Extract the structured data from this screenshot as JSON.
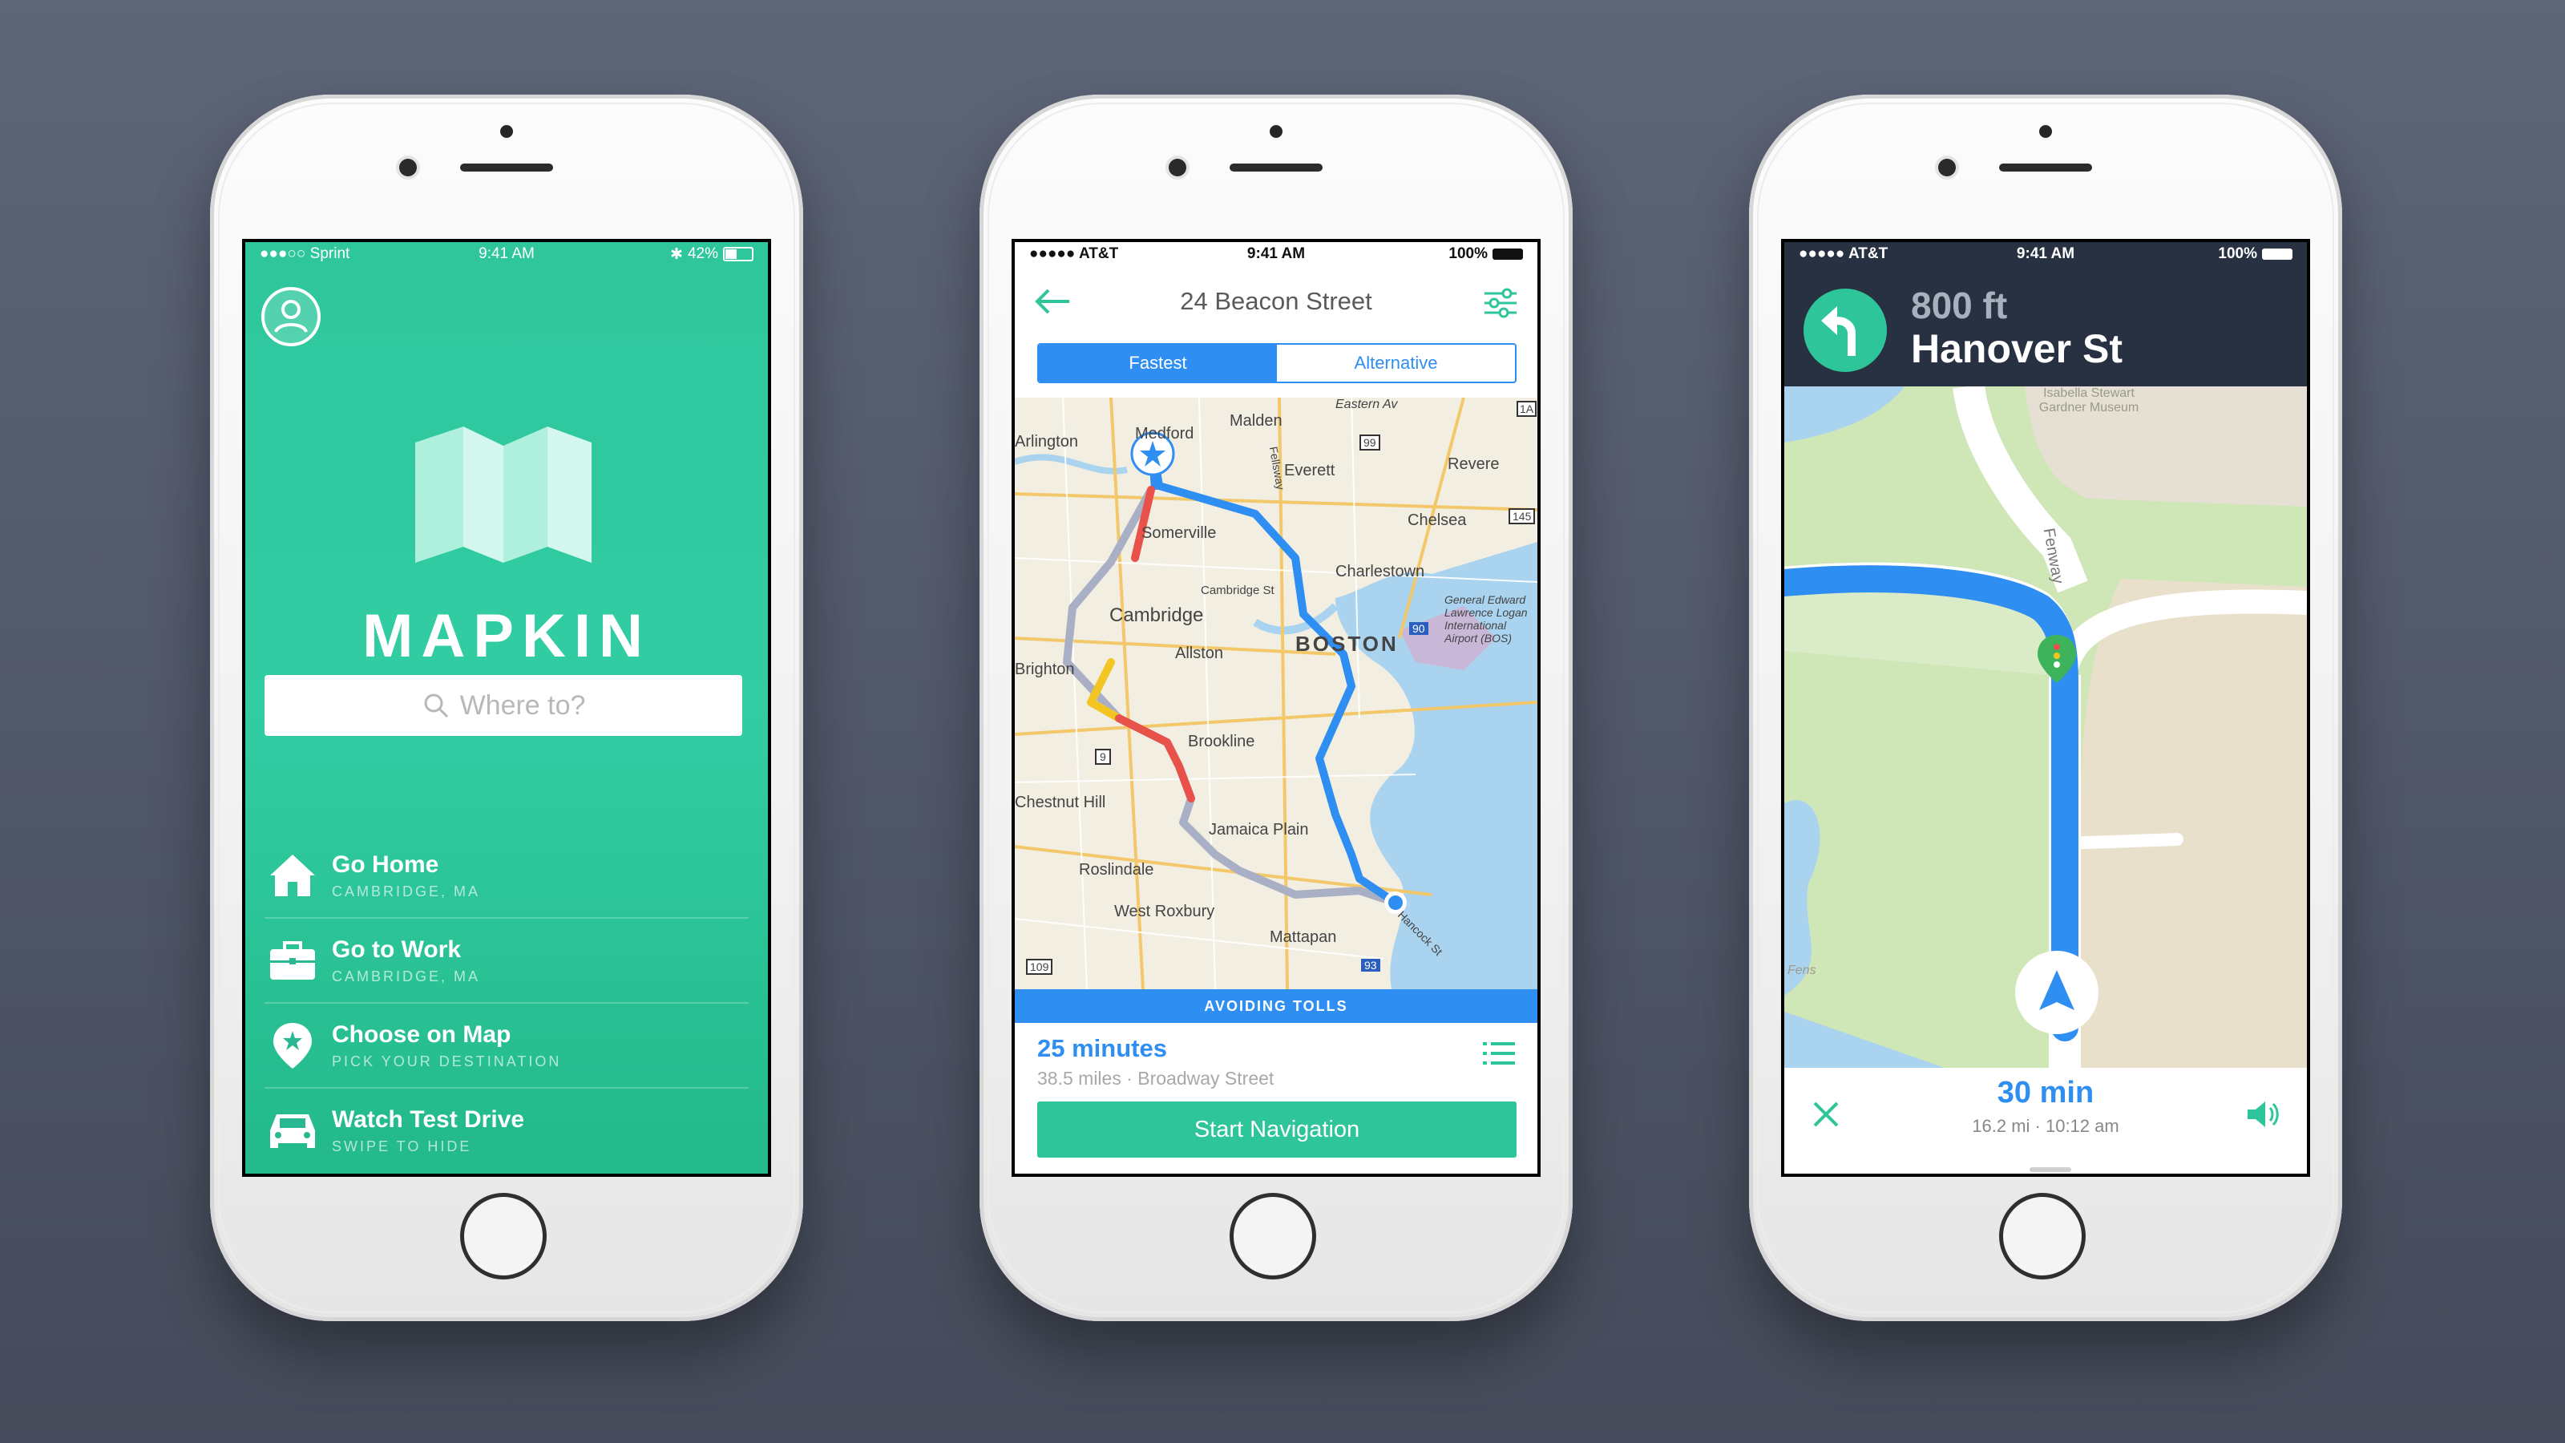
{
  "phone1": {
    "status": {
      "carrier": "●●●○○ Sprint",
      "time": "9:41 AM",
      "battery": "42%"
    },
    "brand": "MAPKIN",
    "search": {
      "placeholder": "Where to?"
    },
    "menu": [
      {
        "title": "Go Home",
        "subtitle": "CAMBRIDGE, MA",
        "icon": "home-icon"
      },
      {
        "title": "Go to Work",
        "subtitle": "CAMBRIDGE, MA",
        "icon": "briefcase-icon"
      },
      {
        "title": "Choose on Map",
        "subtitle": "PICK YOUR DESTINATION",
        "icon": "map-pin-star-icon"
      },
      {
        "title": "Watch Test Drive",
        "subtitle": "SWIPE TO HIDE",
        "icon": "car-icon"
      }
    ],
    "colors": {
      "accent": "#2fc69c"
    }
  },
  "phone2": {
    "status": {
      "carrier": "●●●●● AT&T",
      "time": "9:41 AM",
      "battery": "100%"
    },
    "header": {
      "title": "24 Beacon Street"
    },
    "segments": [
      "Fastest",
      "Alternative"
    ],
    "map_labels": [
      "Eastern Av",
      "Arlington",
      "Medford",
      "Malden",
      "Everett",
      "Revere",
      "Somerville",
      "Chelsea",
      "Cambridge St",
      "Charlestown",
      "Cambridge",
      "Allston",
      "BOSTON",
      "General Edward Lawrence Logan International Airport (BOS)",
      "Brighton",
      "Brookline",
      "Jamaica Plain",
      "Chestnut Hill",
      "Roslindale",
      "West Roxbury",
      "Mattapan",
      "Hancock St",
      "Fellsway",
      "99",
      "145",
      "90",
      "9",
      "93",
      "109",
      "1A"
    ],
    "banner": "AVOIDING TOLLS",
    "summary": {
      "duration": "25 minutes",
      "detail": "38.5 miles · Broadway Street"
    },
    "start_button": "Start Navigation",
    "colors": {
      "route": "#2f8ef1",
      "alt_route": "#a9b0c6",
      "traffic_red": "#e9514b",
      "traffic_yellow": "#f2c523"
    }
  },
  "phone3": {
    "status": {
      "carrier": "●●●●● AT&T",
      "time": "9:41 AM",
      "battery": "100%"
    },
    "maneuver": {
      "distance": "800 ft",
      "street": "Hanover St"
    },
    "map_labels": [
      "Isabella Stewart Gardner Museum",
      "Fenway",
      "Fens"
    ],
    "eta": {
      "duration": "30 min",
      "detail": "16.2 mi · 10:12 am"
    },
    "colors": {
      "route": "#2f8ef1",
      "turn": "#2ec59a",
      "bar": "#273142"
    }
  }
}
